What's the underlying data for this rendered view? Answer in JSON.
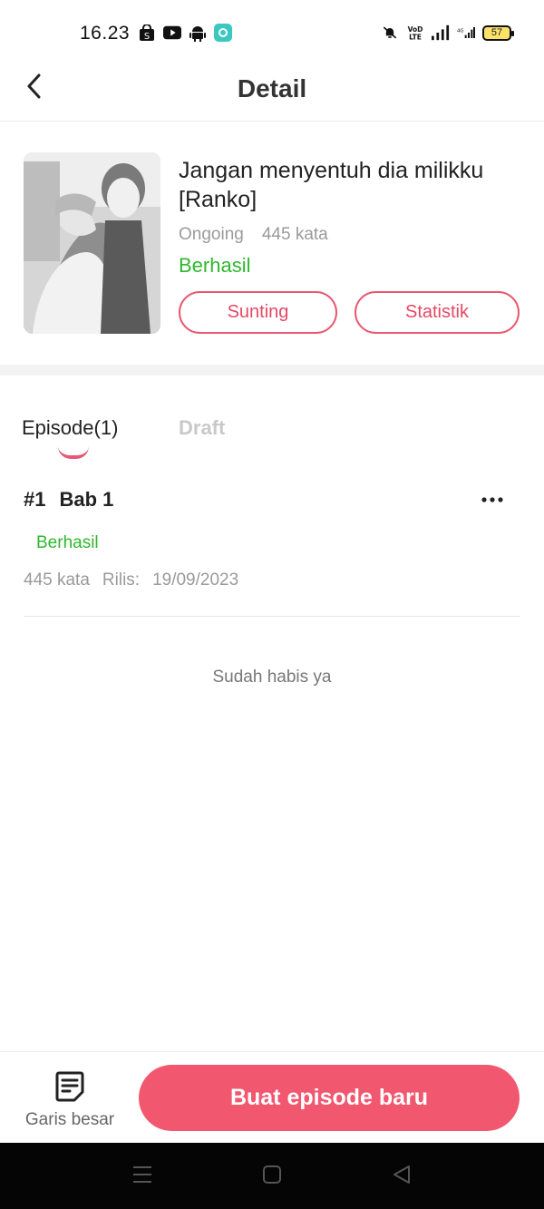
{
  "status_bar": {
    "time": "16.23",
    "battery": "57"
  },
  "header": {
    "title": "Detail"
  },
  "book": {
    "title": "Jangan menyentuh dia milikku [Ranko]",
    "state": "Ongoing",
    "word_count": "445 kata",
    "status": "Berhasil",
    "edit_label": "Sunting",
    "stats_label": "Statistik"
  },
  "tabs": {
    "episode_label": "Episode(1)",
    "draft_label": "Draft"
  },
  "episodes": [
    {
      "number": "#1",
      "title": "Bab 1",
      "status": "Berhasil",
      "word_count": "445 kata",
      "release_label": "Rilis:",
      "release_date": "19/09/2023"
    }
  ],
  "list_end_text": "Sudah habis ya",
  "bottom": {
    "outline_label": "Garis besar",
    "new_episode_label": "Buat episode baru"
  },
  "colors": {
    "accent": "#f25770",
    "success": "#2eb82e",
    "muted": "#9a9a9a"
  },
  "icons": {
    "back": "back-arrow-icon",
    "more": "more-dots-icon",
    "outline": "outline-document-icon",
    "nav_menu": "menu-icon",
    "nav_home": "home-icon",
    "nav_back": "back-triangle-icon"
  }
}
